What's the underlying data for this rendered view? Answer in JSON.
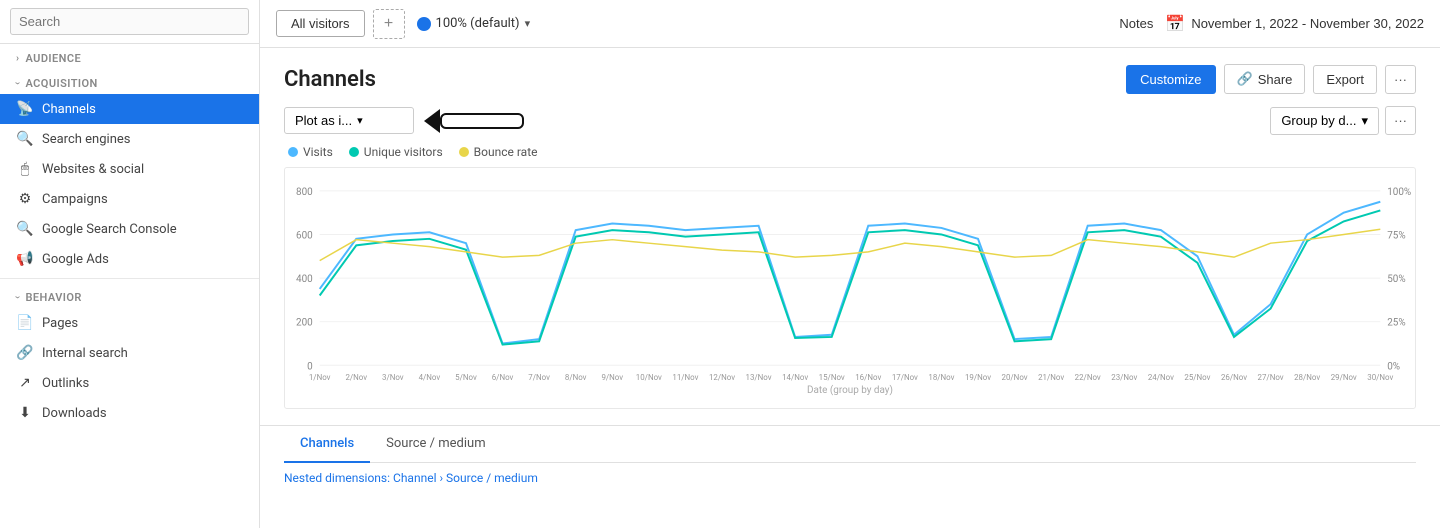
{
  "sidebar": {
    "search_placeholder": "Search",
    "sections": [
      {
        "id": "audience",
        "label": "AUDIENCE",
        "collapsed": false
      },
      {
        "id": "acquisition",
        "label": "ACQUISITION",
        "collapsed": false
      }
    ],
    "items": [
      {
        "id": "channels",
        "label": "Channels",
        "icon": "📡",
        "active": true,
        "section": "acquisition"
      },
      {
        "id": "search-engines",
        "label": "Search engines",
        "icon": "🔍",
        "active": false,
        "section": "acquisition"
      },
      {
        "id": "websites-social",
        "label": "Websites & social",
        "icon": "🖱",
        "active": false,
        "section": "acquisition"
      },
      {
        "id": "campaigns",
        "label": "Campaigns",
        "icon": "⚙",
        "active": false,
        "section": "acquisition"
      },
      {
        "id": "google-search-console",
        "label": "Google Search Console",
        "icon": "🔍",
        "active": false,
        "section": "acquisition"
      },
      {
        "id": "google-ads",
        "label": "Google Ads",
        "icon": "📢",
        "active": false,
        "section": "acquisition"
      },
      {
        "id": "behavior",
        "label": "BEHAVIOR",
        "collapsed": false
      },
      {
        "id": "pages",
        "label": "Pages",
        "icon": "📄",
        "active": false,
        "section": "behavior"
      },
      {
        "id": "internal-search",
        "label": "Internal search",
        "icon": "🔗",
        "active": false,
        "section": "behavior"
      },
      {
        "id": "outlinks",
        "label": "Outlinks",
        "icon": "↗",
        "active": false,
        "section": "behavior"
      },
      {
        "id": "downloads",
        "label": "Downloads",
        "icon": "⬇",
        "active": false,
        "section": "behavior"
      }
    ]
  },
  "topbar": {
    "segment_label": "All visitors",
    "add_segment_label": "+",
    "default_badge_label": "100% (default)",
    "notes_label": "Notes",
    "date_range": "November 1, 2022 - November 30, 2022"
  },
  "page": {
    "title": "Channels",
    "customize_label": "Customize",
    "share_label": "Share",
    "export_label": "Export",
    "more_label": "···"
  },
  "chart": {
    "dropdown_label": "Plot as i...",
    "group_by_label": "Group by d...",
    "legend": [
      {
        "id": "visits",
        "label": "Visits",
        "color": "#4db8ff"
      },
      {
        "id": "unique-visitors",
        "label": "Unique visitors",
        "color": "#00c9b1"
      },
      {
        "id": "bounce-rate",
        "label": "Bounce rate",
        "color": "#e8d54a"
      }
    ],
    "y_axis_left": [
      "800",
      "600",
      "400",
      "200",
      "0"
    ],
    "y_axis_right": [
      "100%",
      "75%",
      "50%",
      "25%",
      "0%"
    ],
    "x_axis": [
      "1/Nov",
      "2/Nov",
      "3/Nov",
      "4/Nov",
      "5/Nov",
      "6/Nov",
      "7/Nov",
      "8/Nov",
      "9/Nov",
      "10/Nov",
      "11/Nov",
      "12/Nov",
      "13/Nov",
      "14/Nov",
      "15/Nov",
      "16/Nov",
      "17/Nov",
      "18/Nov",
      "19/Nov",
      "20/Nov",
      "21/Nov",
      "22/Nov",
      "23/Nov",
      "24/Nov",
      "25/Nov",
      "26/Nov",
      "27/Nov",
      "28/Nov",
      "29/Nov",
      "30/Nov"
    ],
    "x_axis_label": "Date (group by day)",
    "visits_data": [
      350,
      580,
      600,
      610,
      560,
      100,
      120,
      620,
      650,
      640,
      620,
      630,
      640,
      130,
      140,
      640,
      650,
      630,
      580,
      120,
      130,
      640,
      650,
      620,
      500,
      140,
      280,
      600,
      700,
      750
    ],
    "uniq_data": [
      320,
      550,
      570,
      580,
      530,
      95,
      110,
      590,
      620,
      610,
      590,
      600,
      610,
      125,
      130,
      610,
      620,
      600,
      550,
      110,
      120,
      610,
      620,
      590,
      470,
      130,
      260,
      570,
      660,
      710
    ],
    "bounce_data": [
      60,
      72,
      70,
      68,
      65,
      62,
      63,
      70,
      72,
      70,
      68,
      66,
      65,
      62,
      63,
      65,
      70,
      68,
      65,
      62,
      63,
      72,
      70,
      68,
      65,
      62,
      70,
      72,
      75,
      78
    ]
  },
  "tabs": {
    "items": [
      {
        "id": "channels",
        "label": "Channels",
        "active": true
      },
      {
        "id": "source-medium",
        "label": "Source / medium",
        "active": false
      }
    ],
    "nested_dimensions_prefix": "Nested dimensions: ",
    "nested_dimensions_value": "Channel › Source / medium"
  }
}
